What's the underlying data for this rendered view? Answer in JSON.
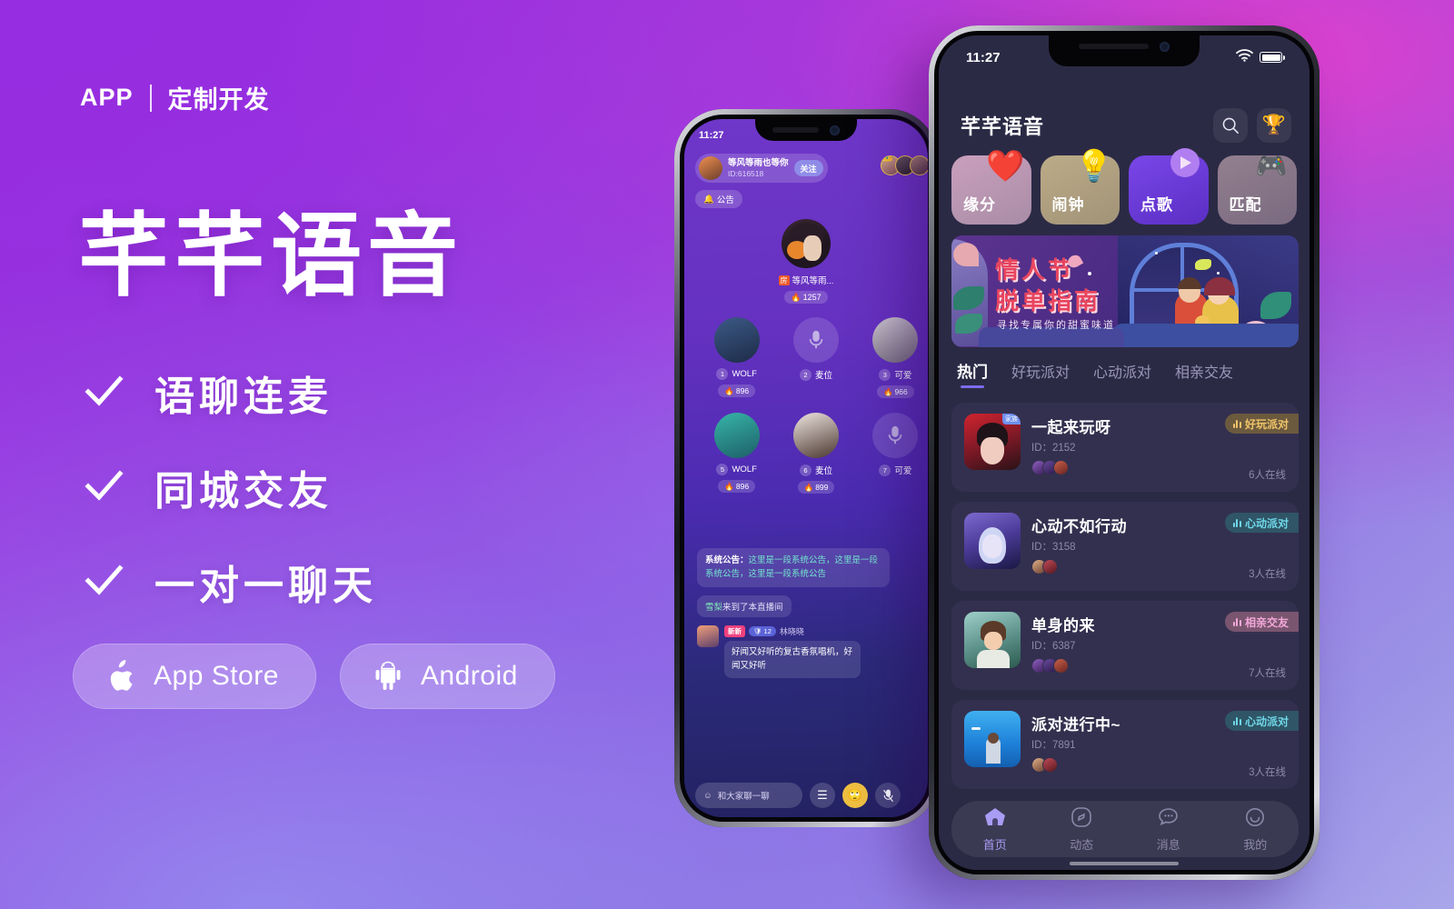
{
  "brand": {
    "eyebrow_left": "APP",
    "eyebrow_right": "定制开发",
    "title": "芊芊语音",
    "accent": "#7d6cf0"
  },
  "features": [
    {
      "label": "语聊连麦",
      "icon": "check-icon"
    },
    {
      "label": "同城交友",
      "icon": "check-icon"
    },
    {
      "label": "一对一聊天",
      "icon": "check-icon"
    }
  ],
  "stores": [
    {
      "label": "App Store",
      "icon": "apple-icon"
    },
    {
      "label": "Android",
      "icon": "android-icon"
    }
  ],
  "front_phone": {
    "status": {
      "time": "11:27",
      "wifi": "wifi-icon",
      "battery": "battery-icon"
    },
    "header": {
      "logo": "芊芊语音",
      "search": "search-icon",
      "rank": "trophy-icon"
    },
    "entries": [
      {
        "label": "缘分",
        "icon": "heart-icon",
        "bg1": "#c49ab8",
        "bg2": "#b58fae"
      },
      {
        "label": "闹钟",
        "icon": "bulb-icon",
        "bg1": "#b6a483",
        "bg2": "#a8987c"
      },
      {
        "label": "点歌",
        "icon": "play-icon",
        "bg1": "#6f3fe0",
        "bg2": "#5b31cc"
      },
      {
        "label": "匹配",
        "icon": "gamepad-icon",
        "bg1": "#8d7d92",
        "bg2": "#7a6b84"
      }
    ],
    "banner": {
      "line1": "情人节",
      "line2": "脱单指南",
      "sub": "寻找专属你的甜蜜味道"
    },
    "tabs": [
      {
        "label": "热门",
        "active": true
      },
      {
        "label": "好玩派对",
        "active": false
      },
      {
        "label": "心动派对",
        "active": false
      },
      {
        "label": "相亲交友",
        "active": false
      }
    ],
    "rooms": [
      {
        "name": "一起来玩呀",
        "id_label": "ID：2152",
        "online": "6人在线",
        "badge": "好玩派对",
        "badge_bg": "#6b5a3e",
        "badge_fg": "#f0c469",
        "family_tag": "家族",
        "cover1": "#c8202a",
        "cover2": "#3a1620",
        "members": [
          "#7b4fa8",
          "#5a3a86",
          "#b04a3a"
        ]
      },
      {
        "name": "心动不如行动",
        "id_label": "ID：3158",
        "online": "3人在线",
        "badge": "心动派对",
        "badge_bg": "#2f5566",
        "badge_fg": "#6fd7e8",
        "family_tag": "",
        "cover1": "#5a4bb0",
        "cover2": "#1c1a4a",
        "members": [
          "#c39070",
          "#a33a4a"
        ]
      },
      {
        "name": "单身的来",
        "id_label": "ID：6387",
        "online": "7人在线",
        "badge": "相亲交友",
        "badge_bg": "#7a5570",
        "badge_fg": "#f2a8d8",
        "family_tag": "",
        "cover1": "#8ac0b8",
        "cover2": "#3d6a58",
        "members": [
          "#7b4fa8",
          "#5a3a86",
          "#b04a3a"
        ]
      },
      {
        "name": "派对进行中~",
        "id_label": "ID：7891",
        "online": "3人在线",
        "badge": "心动派对",
        "badge_bg": "#2f5566",
        "badge_fg": "#6fd7e8",
        "family_tag": "",
        "cover1": "#2f9fe8",
        "cover2": "#1668b8",
        "members": [
          "#c39070",
          "#a33a4a"
        ]
      }
    ],
    "nav": [
      {
        "label": "首页",
        "icon": "home-icon",
        "active": true
      },
      {
        "label": "动态",
        "icon": "compass-icon",
        "active": false
      },
      {
        "label": "消息",
        "icon": "chat-icon",
        "active": false
      },
      {
        "label": "我的",
        "icon": "smile-icon",
        "active": false
      }
    ]
  },
  "back_phone": {
    "status": {
      "time": "11:27"
    },
    "owner": {
      "name": "等风等雨也等你",
      "id_label": "ID:616518",
      "follow": "关注"
    },
    "notice": {
      "label": "公告",
      "icon": "bell-icon"
    },
    "host": {
      "tag": "房",
      "name": "等风等雨...",
      "hot": "1257",
      "hot_icon": "fire-icon"
    },
    "seats": [
      {
        "num": "1",
        "label": "WOLF",
        "hot": "896",
        "empty": false,
        "c1": "#3c5a86",
        "c2": "#1d2b48"
      },
      {
        "num": "2",
        "label": "麦位",
        "hot": "",
        "empty": true,
        "c1": "",
        "c2": ""
      },
      {
        "num": "3",
        "label": "可爱",
        "hot": "966",
        "empty": false,
        "c1": "#c9c3cd",
        "c2": "#6f6878"
      },
      {
        "num": "5",
        "label": "WOLF",
        "hot": "896",
        "empty": false,
        "c1": "#37b5a8",
        "c2": "#1d5f68"
      },
      {
        "num": "6",
        "label": "麦位",
        "hot": "899",
        "empty": false,
        "c1": "#8a7060",
        "c2": "#3a2a28"
      },
      {
        "num": "7",
        "label": "可爱",
        "hot": "",
        "empty": true,
        "c1": "",
        "c2": ""
      }
    ],
    "chat": {
      "system_prefix": "系统公告：",
      "system_text": "这里是一段系统公告，这里是一段系统公告，这里是一段系统公告",
      "join_user": "雪梨",
      "join_text": "来到了本直播间",
      "message": {
        "tag_new": "新新",
        "level": "12",
        "name": "林晓晓",
        "text": "好闻又好听的复古香氛唱机，好闻又好听"
      }
    },
    "bottom": {
      "input_placeholder": "和大家聊一聊",
      "emoji": "smile-icon",
      "buttons": [
        "menu-icon",
        "emoji-icon",
        "mic-off-icon"
      ]
    }
  }
}
